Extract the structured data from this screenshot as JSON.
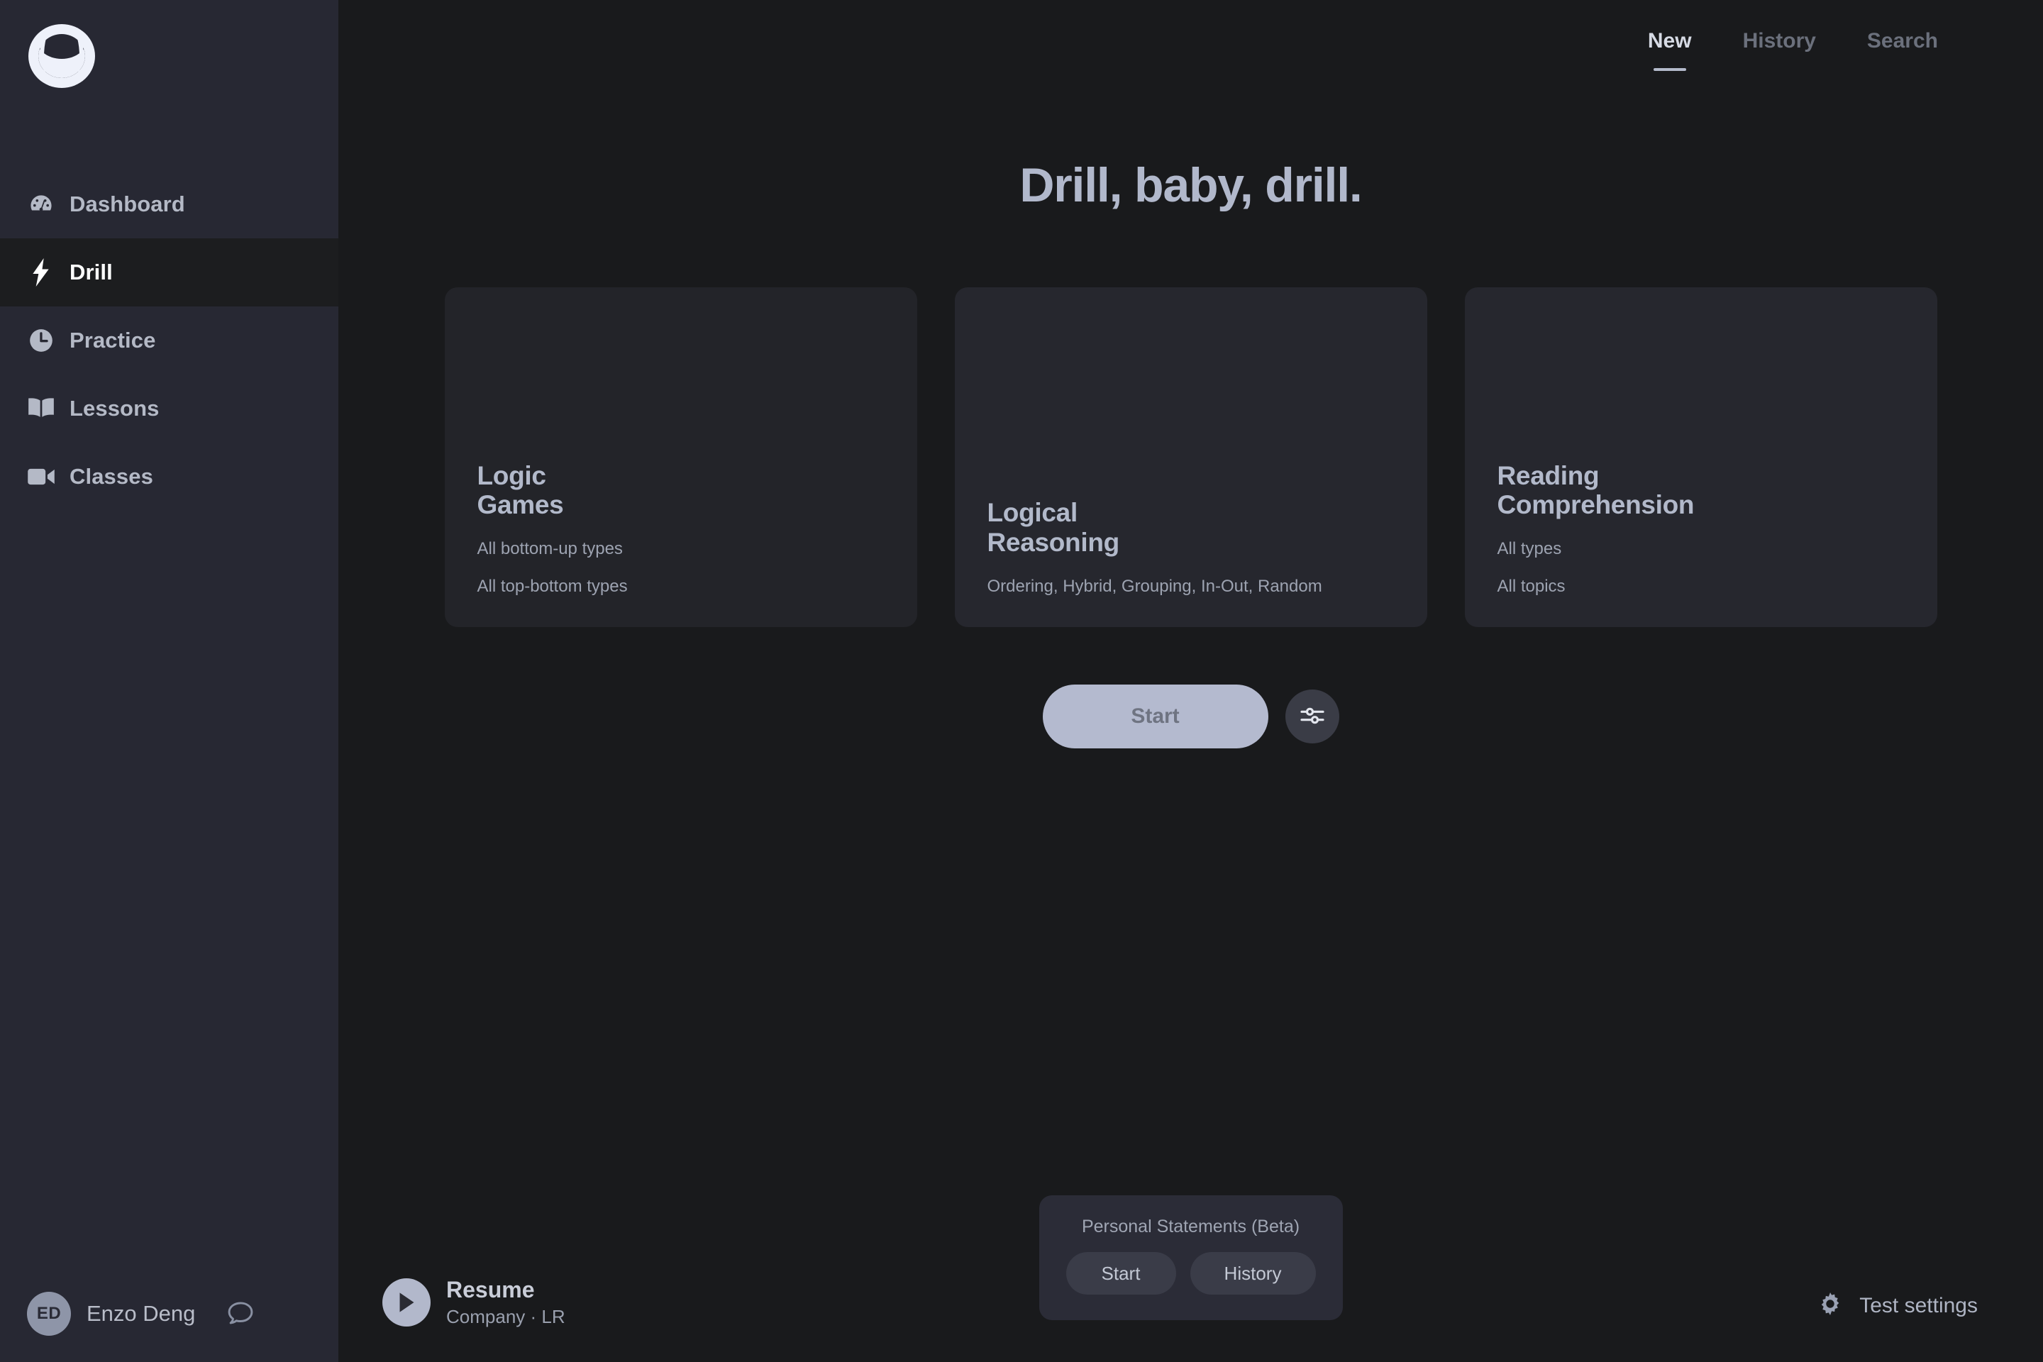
{
  "app": {
    "logo_name": "moon-horns-logo"
  },
  "sidebar": {
    "items": [
      {
        "label": "Dashboard",
        "icon": "gauge-icon",
        "active": false
      },
      {
        "label": "Drill",
        "icon": "lightning-bolt-icon",
        "active": true
      },
      {
        "label": "Practice",
        "icon": "clock-icon",
        "active": false
      },
      {
        "label": "Lessons",
        "icon": "open-book-icon",
        "active": false
      },
      {
        "label": "Classes",
        "icon": "video-camera-icon",
        "active": false
      }
    ],
    "footer": {
      "avatar_initials": "ED",
      "user_name": "Enzo Deng",
      "chat_icon": "chat-bubble-icon"
    }
  },
  "top_tabs": [
    {
      "label": "New",
      "active": true
    },
    {
      "label": "History",
      "active": false
    },
    {
      "label": "Search",
      "active": false
    }
  ],
  "hero": {
    "title": "Drill, baby, drill."
  },
  "cards": [
    {
      "title_line1": "Logic",
      "title_line2": "Games",
      "subs": [
        "All bottom-up types",
        "All top-bottom types"
      ],
      "variant": "dim"
    },
    {
      "title_line1": "Logical",
      "title_line2": "Reasoning",
      "subs": [
        "Ordering, Hybrid, Grouping, In-Out, Random"
      ],
      "variant": "normal"
    },
    {
      "title_line1": "Reading",
      "title_line2": "Comprehension",
      "subs": [
        "All types",
        "All topics"
      ],
      "variant": "normal"
    }
  ],
  "actions": {
    "start_label": "Start",
    "filters_icon": "sliders-icon"
  },
  "personal_statements": {
    "title": "Personal Statements (Beta)",
    "start_label": "Start",
    "history_label": "History"
  },
  "resume": {
    "play_icon": "play-icon",
    "title": "Resume",
    "subtitle": "Company · LR"
  },
  "test_settings": {
    "icon": "gear-icon",
    "label": "Test settings"
  },
  "colors": {
    "sidebar_bg": "#272833",
    "main_bg": "#191a1c",
    "card_bg": "#26272e",
    "card_bg_dim": "#232429",
    "accent": "#b4bacf",
    "text_primary": "#b2b9ca",
    "text_muted": "#9da3b1"
  }
}
